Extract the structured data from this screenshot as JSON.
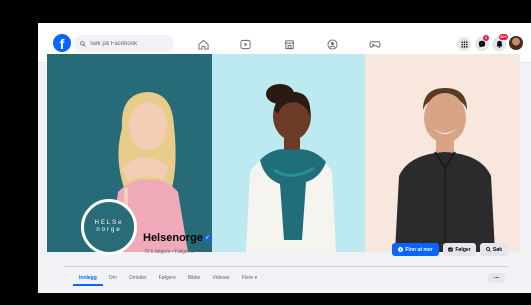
{
  "header": {
    "logo_glyph": "f",
    "search_placeholder": "Søk på Facebook",
    "nav_icons": [
      "home-icon",
      "video-icon",
      "marketplace-icon",
      "groups-icon",
      "gaming-icon"
    ],
    "right_icons": [
      "menu-grid-icon",
      "messenger-icon",
      "notifications-icon",
      "account-avatar"
    ],
    "messenger_badge": "1",
    "notifications_badge": "20+"
  },
  "profile": {
    "logo_top": "HELSe",
    "logo_bottom": "norge",
    "name": "Helsenorge",
    "verified_glyph": "✓",
    "stats": "70 k følgere • Følger 9"
  },
  "actions": {
    "find_out_more": "Finn ut mer",
    "follow": "Følger",
    "search": "Søk"
  },
  "tabs": [
    "Innlegg",
    "Om",
    "Omtaler",
    "Følgere",
    "Bilder",
    "Videoer",
    "Flere ▾"
  ],
  "more_menu": "...",
  "colors": {
    "brand_blue": "#0866ff",
    "cover_teal": "#286b78",
    "cover_light_blue": "#bde9f1",
    "cover_peach": "#f8e7dc"
  }
}
